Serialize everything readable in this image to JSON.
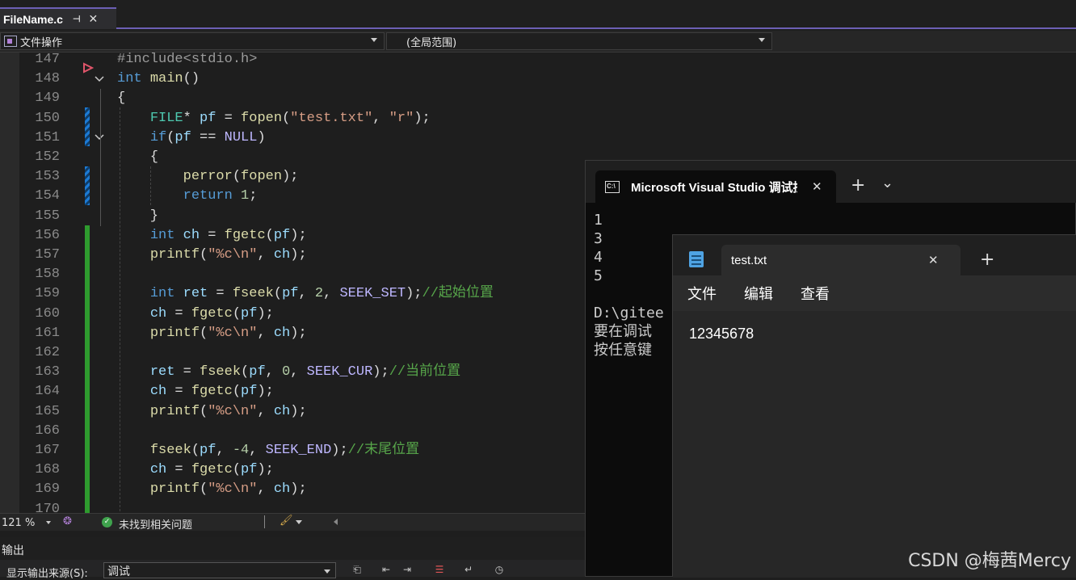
{
  "ide": {
    "tab_label": "FileName.c",
    "pin_glyph": "⊣",
    "close_glyph": "✕",
    "scope_left": "文件操作",
    "scope_right": "(全局范围)"
  },
  "code_lines": [
    {
      "num": "147",
      "html": "<span class=\"p\">#include&lt;stdio.h&gt;</span>"
    },
    {
      "num": "148",
      "html": "<span class=\"k\">int</span> <span class=\"f\">main</span>()"
    },
    {
      "num": "149",
      "html": "{"
    },
    {
      "num": "150",
      "html": "    <span class=\"t\">FILE</span>* <span class=\"v\">pf</span> = <span class=\"f\">fopen</span>(<span class=\"s\">\"test.txt\"</span>, <span class=\"s\">\"r\"</span>);"
    },
    {
      "num": "151",
      "html": "    <span class=\"k\">if</span>(<span class=\"v\">pf</span> == <span class=\"m\">NULL</span>)"
    },
    {
      "num": "152",
      "html": "    {"
    },
    {
      "num": "153",
      "html": "        <span class=\"f\">perror</span>(<span class=\"f\">fopen</span>);"
    },
    {
      "num": "154",
      "html": "        <span class=\"k\">return</span> <span class=\"n\">1</span>;"
    },
    {
      "num": "155",
      "html": "    }"
    },
    {
      "num": "156",
      "html": "    <span class=\"k\">int</span> <span class=\"v\">ch</span> = <span class=\"f\">fgetc</span>(<span class=\"v\">pf</span>);"
    },
    {
      "num": "157",
      "html": "    <span class=\"f\">printf</span>(<span class=\"s\">\"%c\\n\"</span>, <span class=\"v\">ch</span>);"
    },
    {
      "num": "158",
      "html": ""
    },
    {
      "num": "159",
      "html": "    <span class=\"k\">int</span> <span class=\"v\">ret</span> = <span class=\"f\">fseek</span>(<span class=\"v\">pf</span>, <span class=\"n\">2</span>, <span class=\"m\">SEEK_SET</span>);<span class=\"c\">//起始位置</span>"
    },
    {
      "num": "160",
      "html": "    <span class=\"v\">ch</span> = <span class=\"f\">fgetc</span>(<span class=\"v\">pf</span>);"
    },
    {
      "num": "161",
      "html": "    <span class=\"f\">printf</span>(<span class=\"s\">\"%c\\n\"</span>, <span class=\"v\">ch</span>);"
    },
    {
      "num": "162",
      "html": ""
    },
    {
      "num": "163",
      "html": "    <span class=\"v\">ret</span> = <span class=\"f\">fseek</span>(<span class=\"v\">pf</span>, <span class=\"n\">0</span>, <span class=\"m\">SEEK_CUR</span>);<span class=\"c\">//当前位置</span>"
    },
    {
      "num": "164",
      "html": "    <span class=\"v\">ch</span> = <span class=\"f\">fgetc</span>(<span class=\"v\">pf</span>);"
    },
    {
      "num": "165",
      "html": "    <span class=\"f\">printf</span>(<span class=\"s\">\"%c\\n\"</span>, <span class=\"v\">ch</span>);"
    },
    {
      "num": "166",
      "html": ""
    },
    {
      "num": "167",
      "html": "    <span class=\"f\">fseek</span>(<span class=\"v\">pf</span>, <span class=\"n\">-4</span>, <span class=\"m\">SEEK_END</span>);<span class=\"c\">//末尾位置</span>"
    },
    {
      "num": "168",
      "html": "    <span class=\"v\">ch</span> = <span class=\"f\">fgetc</span>(<span class=\"v\">pf</span>);"
    },
    {
      "num": "169",
      "html": "    <span class=\"f\">printf</span>(<span class=\"s\">\"%c\\n\"</span>, <span class=\"v\">ch</span>);"
    },
    {
      "num": "170",
      "html": ""
    }
  ],
  "status": {
    "zoom": "121 %",
    "issues": "未找到相关问题"
  },
  "output": {
    "title": "输出",
    "source_label": "显示输出来源(S):",
    "source_value": "调试"
  },
  "console": {
    "tab_title": "Microsoft Visual Studio 调试控",
    "plus": "+",
    "chevron": "⌄",
    "close": "✕",
    "text": "1\n3\n4\n5\n\nD:\\gitee\n要在调试\n按任意键"
  },
  "notepad": {
    "tab_title": "test.txt",
    "close": "✕",
    "plus": "+",
    "menu_file": "文件",
    "menu_edit": "编辑",
    "menu_view": "查看",
    "content": "12345678"
  },
  "watermark": "CSDN @梅茜Mercy"
}
